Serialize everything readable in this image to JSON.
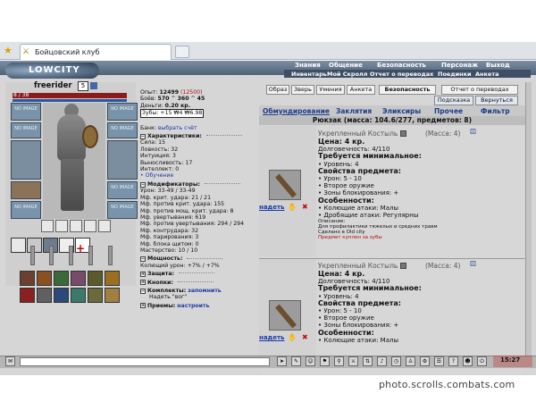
{
  "browser": {
    "tab_title": "Бойцовский клуб"
  },
  "game": {
    "logo_text": "LOWCITY",
    "menu_row1": [
      "Знания",
      "Общение",
      "Безопасность",
      "Персонаж",
      "Выход"
    ],
    "menu_row2": [
      "Инвентарь",
      "Мой Скролл",
      "Отчет о переводах",
      "Поединки",
      "Анкета"
    ]
  },
  "character": {
    "nick": "freerider",
    "level": "5",
    "hp": "8 / 38",
    "slot_empty": "NO IMAGE"
  },
  "stats": {
    "exp_label": "Опыт:",
    "exp_value": "12499",
    "exp_next": "(12500)",
    "battles_label": "Боёв:",
    "battles_value": "570",
    "battles_win": "360",
    "battles_lose": "45",
    "money_label": "Деньги:",
    "money_value": "0.20 кр.",
    "teeth_label": "Зубы:",
    "teeth_value": "+15 ₩4 ₩6.98",
    "bank_label": "Банк:",
    "bank_link": "выбрать счёт",
    "char_head": "Характеристики:",
    "sila": "Сила: 15",
    "lovk": "Ловкость: 32",
    "intu": "Интуиция: 3",
    "vyn": "Выносливость: 17",
    "intel": "Интеллект: 0",
    "obuch": "• Обучение",
    "mods_head": "Модификаторы:",
    "mods": [
      "Урон: 33-49 / 33-49",
      "Мф. крит. удара: 21 / 21",
      "Мф. против крит. удара: 155",
      "Мф. против мощ. крит. удара: 8",
      "Мф. увертывания: 619",
      "Мф. против увертывания: 294 / 294",
      "Мф. контрудара: 32",
      "Мф. парирования: 3",
      "Мф. блока щитом: 0",
      "Мастерство: 10 / 10",
      "Колющий урон: +7% / +7%"
    ],
    "power_head": "Мощность:",
    "armor_head": "Защита:",
    "buttons_head": "Кнопки:",
    "sets_head": "Комплекты:",
    "sets_link": "запомнить",
    "sets_item": "Надеть \"вог\"",
    "recv_head": "Приемы:",
    "recv_link": "настроить"
  },
  "top_buttons": [
    "Образ",
    "Зверь",
    "Умения",
    "Анкета",
    "Безопасность",
    "Отчет о переводах"
  ],
  "sub_buttons": [
    "Подсказка",
    "Вернуться"
  ],
  "tabs": [
    "Обмундирование",
    "Заклятия",
    "Эликсиры",
    "Прочее",
    "Фильтр"
  ],
  "backpack": "Рюкзак (масса: 104.6/277, предметов: 8)",
  "items": [
    {
      "name": "Укрепленный Костыль",
      "mass": "(Масса: 4)",
      "price": "Цена: 4 кр.",
      "durability": "Долговечность: 4/110",
      "req_title": "Требуется минимальное:",
      "req": "• Уровень: 4",
      "props_title": "Свойства предмета:",
      "props": [
        "• Урон: 5 - 10",
        "• Второе оружие",
        "• Зоны блокирования: +"
      ],
      "feat_title": "Особенности:",
      "feats": [
        "• Колющие атаки: Малы",
        "• Дробящие атаки: Регулярны"
      ],
      "desc_title": "Описание:",
      "desc": "Для профилактики тяжелых и средних травм",
      "made": "Сделано в Old city",
      "bought": "Предмет куплен за зубы",
      "wear": "надеть"
    },
    {
      "name": "Укрепленный Костыль",
      "mass": "(Масса: 4)",
      "price": "Цена: 4 кр.",
      "durability": "Долговечность: 4/110",
      "req_title": "Требуется минимальное:",
      "req": "• Уровень: 4",
      "props_title": "Свойства предмета:",
      "props": [
        "• Урон: 5 - 10",
        "• Второе оружие",
        "• Зоны блокирования: +"
      ],
      "feat_title": "Особенности:",
      "feats": [
        "• Колющие атаки: Малы"
      ],
      "wear": "надеть"
    }
  ],
  "clock": "15:27",
  "watermark": "photo.scrolls.combats.com"
}
